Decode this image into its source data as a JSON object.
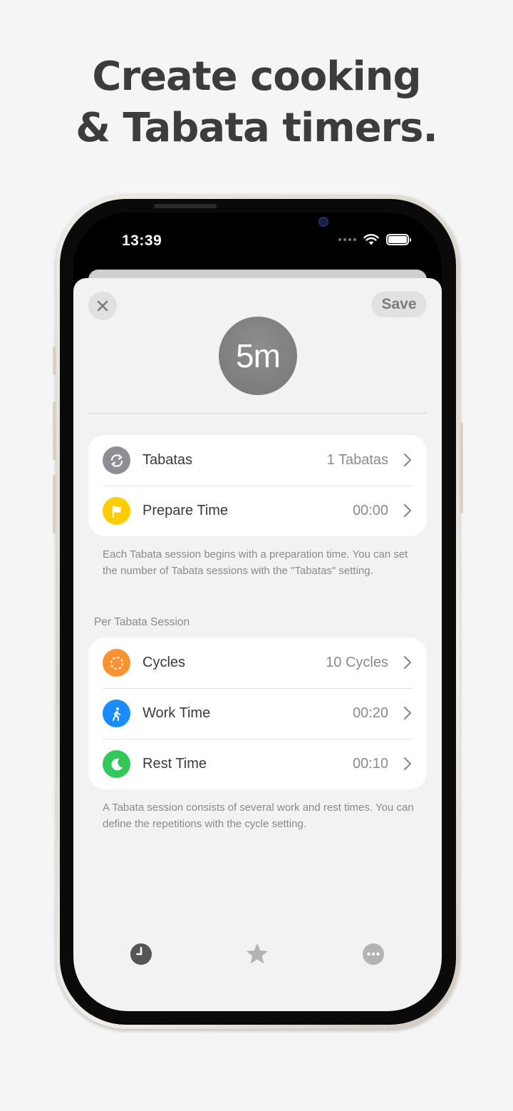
{
  "headline": {
    "line1": "Create cooking",
    "line2": "& Tabata timers."
  },
  "status_bar": {
    "time": "13:39"
  },
  "toolbar": {
    "close_icon": "xmark",
    "save_label": "Save"
  },
  "timer": {
    "duration": "5m"
  },
  "general_group": {
    "rows": [
      {
        "label": "Tabatas",
        "value": "1 Tabatas",
        "icon": "repeat-icon",
        "color": "#8e8e93"
      },
      {
        "label": "Prepare Time",
        "value": "00:00",
        "icon": "flag-icon",
        "color": "#ffcc00"
      }
    ],
    "footnote": "Each Tabata session begins with a preparation time. You can set the number of Tabata sessions with the \"Tabatas\" setting."
  },
  "session_group": {
    "header": "Per Tabata Session",
    "rows": [
      {
        "label": "Cycles",
        "value": "10 Cycles",
        "icon": "dashed-circle-icon",
        "color": "#ff9230"
      },
      {
        "label": "Work Time",
        "value": "00:20",
        "icon": "walking-figure-icon",
        "color": "#1a8cff"
      },
      {
        "label": "Rest Time",
        "value": "00:10",
        "icon": "moon-icon",
        "color": "#34c759"
      }
    ],
    "footnote": "A Tabata session consists of several work and rest times. You can define the repetitions with the cycle setting."
  },
  "tab_bar": {
    "tabs": [
      {
        "icon": "clock-icon",
        "selected": true
      },
      {
        "icon": "star-icon",
        "selected": false
      },
      {
        "icon": "ellipsis-circle-icon",
        "selected": false
      }
    ]
  }
}
